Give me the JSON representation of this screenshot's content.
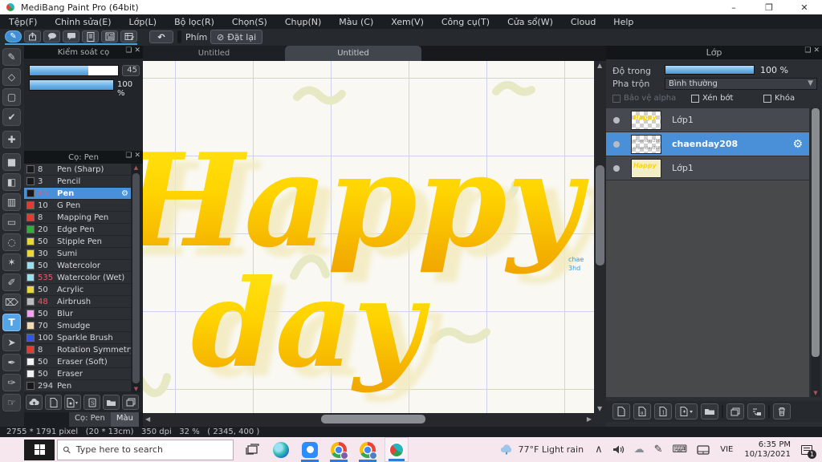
{
  "window": {
    "title": "MediBang Paint Pro (64bit)",
    "minimize": "–",
    "restore": "❐",
    "close": "✕"
  },
  "menu": {
    "items": [
      "Tệp(F)",
      "Chỉnh sửa(E)",
      "Lớp(L)",
      "Bộ lọc(R)",
      "Chọn(S)",
      "Chụp(N)",
      "Màu (C)",
      "Xem(V)",
      "Công cụ(T)",
      "Cửa sổ(W)",
      "Cloud",
      "Help"
    ]
  },
  "toolbar": {
    "undo_glyph": "↶",
    "key_label": "Phím",
    "reset_icon": "⊘",
    "reset_label": "Đặt lại"
  },
  "tools": [
    {
      "name": "brush",
      "glyph": "✎"
    },
    {
      "name": "eraser",
      "glyph": "◇"
    },
    {
      "name": "shape",
      "glyph": "▢"
    },
    {
      "name": "snap",
      "glyph": "✔"
    },
    {
      "name": "move",
      "glyph": "✚"
    },
    {
      "name": "select-fill",
      "glyph": "■"
    },
    {
      "name": "bucket",
      "glyph": "◧"
    },
    {
      "name": "gradient",
      "glyph": "▥"
    },
    {
      "name": "select-rect",
      "glyph": "▭"
    },
    {
      "name": "lasso",
      "glyph": "◌"
    },
    {
      "name": "magic-wand",
      "glyph": "✶"
    },
    {
      "name": "select-pen",
      "glyph": "✐"
    },
    {
      "name": "select-eraser",
      "glyph": "⌦"
    },
    {
      "name": "text",
      "glyph": "T",
      "selected": true
    },
    {
      "name": "operation",
      "glyph": "➤"
    },
    {
      "name": "eyedropper",
      "glyph": "✒"
    },
    {
      "name": "measure",
      "glyph": "✑"
    },
    {
      "name": "hand",
      "glyph": "☞"
    }
  ],
  "brush_control": {
    "title": "Kiểm soát cọ",
    "popout_icon": "❏",
    "close_icon": "✕",
    "size_value": "45",
    "opacity_value": "100 %"
  },
  "brush_panel": {
    "title": "Cọ: Pen",
    "popout_icon": "❏",
    "close_icon": "✕",
    "gear_icon": "⚙",
    "brushes": [
      {
        "size": "8",
        "name": "Pen (Sharp)",
        "swatch": "#17191c",
        "num_color": "#cfd2d6"
      },
      {
        "size": "3",
        "name": "Pencil",
        "swatch": "#17191c",
        "num_color": "#cfd2d6"
      },
      {
        "size": "45",
        "name": "Pen",
        "swatch": "#17191c",
        "num_color": "#e2606a"
      },
      {
        "size": "10",
        "name": "G Pen",
        "swatch": "#e23c32",
        "num_color": "#cfd2d6"
      },
      {
        "size": "8",
        "name": "Mapping Pen",
        "swatch": "#e23c32",
        "num_color": "#cfd2d6"
      },
      {
        "size": "20",
        "name": "Edge Pen",
        "swatch": "#2fae3a",
        "num_color": "#cfd2d6"
      },
      {
        "size": "50",
        "name": "Stipple Pen",
        "swatch": "#e8d73c",
        "num_color": "#cfd2d6"
      },
      {
        "size": "30",
        "name": "Sumi",
        "swatch": "#e8d73c",
        "num_color": "#cfd2d6"
      },
      {
        "size": "50",
        "name": "Watercolor",
        "swatch": "#9adef0",
        "num_color": "#cfd2d6"
      },
      {
        "size": "535",
        "name": "Watercolor (Wet)",
        "swatch": "#9adef0",
        "num_color": "#e2606a"
      },
      {
        "size": "50",
        "name": "Acrylic",
        "swatch": "#e8d73c",
        "num_color": "#cfd2d6"
      },
      {
        "size": "48",
        "name": "Airbrush",
        "swatch": "#b9bcbe",
        "num_color": "#e2606a"
      },
      {
        "size": "50",
        "name": "Blur",
        "swatch": "#f2a3ef",
        "num_color": "#cfd2d6"
      },
      {
        "size": "70",
        "name": "Smudge",
        "swatch": "#f4d9b6",
        "num_color": "#cfd2d6"
      },
      {
        "size": "100",
        "name": "Sparkle Brush",
        "swatch": "#3256e2",
        "num_color": "#cfd2d6"
      },
      {
        "size": "8",
        "name": "Rotation Symmetry Pe",
        "swatch": "#e23c32",
        "num_color": "#cfd2d6"
      },
      {
        "size": "50",
        "name": "Eraser (Soft)",
        "swatch": "#f2f3f4",
        "num_color": "#cfd2d6"
      },
      {
        "size": "50",
        "name": "Eraser",
        "swatch": "#f2f3f4",
        "num_color": "#cfd2d6"
      },
      {
        "size": "294",
        "name": "Pen",
        "swatch": "#17191c",
        "num_color": "#cfd2d6"
      }
    ]
  },
  "panel_tabs": {
    "brush": "Cọ: Pen",
    "color": "Màu"
  },
  "canvas": {
    "tabs": [
      "Untitled",
      "Untitled"
    ],
    "artwork_line1": "Happy",
    "artwork_line2": "day",
    "watermark_line1": "chae",
    "watermark_line2": "3hd"
  },
  "layers_panel": {
    "title": "Lớp",
    "popout_icon": "❏",
    "close_icon": "✕",
    "opacity_label": "Độ trong",
    "opacity_value": "100 %",
    "blend_label": "Pha trộn",
    "blend_value": "Bình thường",
    "checkbox_alpha": "Bảo vệ alpha",
    "checkbox_clip": "Xén bớt",
    "checkbox_lock": "Khóa",
    "gear_icon": "⚙",
    "layers": [
      {
        "name": "Lớp1",
        "thumb_text": "Happy"
      },
      {
        "name": "chaenday208",
        "thumb_text": "chaenday208 chaenday208"
      },
      {
        "name": "Lớp1",
        "thumb_text": "Happy"
      }
    ]
  },
  "status_bar": {
    "text": "2755 * 1791 pixel   (20 * 13cm)   350 dpi   32 %   ( 2345, 400 )"
  },
  "taskbar": {
    "search_placeholder": "Type here to search",
    "weather_temp": "77°F",
    "weather_desc": "Light rain",
    "chevron": "∧",
    "cloud_icon": "☁",
    "pen_icon": "✎",
    "keyboard_icon": "⌨",
    "language": "VIE",
    "time": "6:35 PM",
    "date": "10/13/2021",
    "notification_count": "1"
  },
  "colors": {
    "accent": "#4a90d9",
    "selection": "#4a90d9",
    "canvas_bg": "#f9f8f2",
    "grid": "#cdd1ec",
    "letter_top": "#ffe616",
    "letter_bottom": "#f0a400",
    "ghost": "#f3eabc",
    "squiggle": "#e7e9c5",
    "watermark_blue": "#2d9fe8",
    "taskbar_bg": "#f6e7ef"
  }
}
